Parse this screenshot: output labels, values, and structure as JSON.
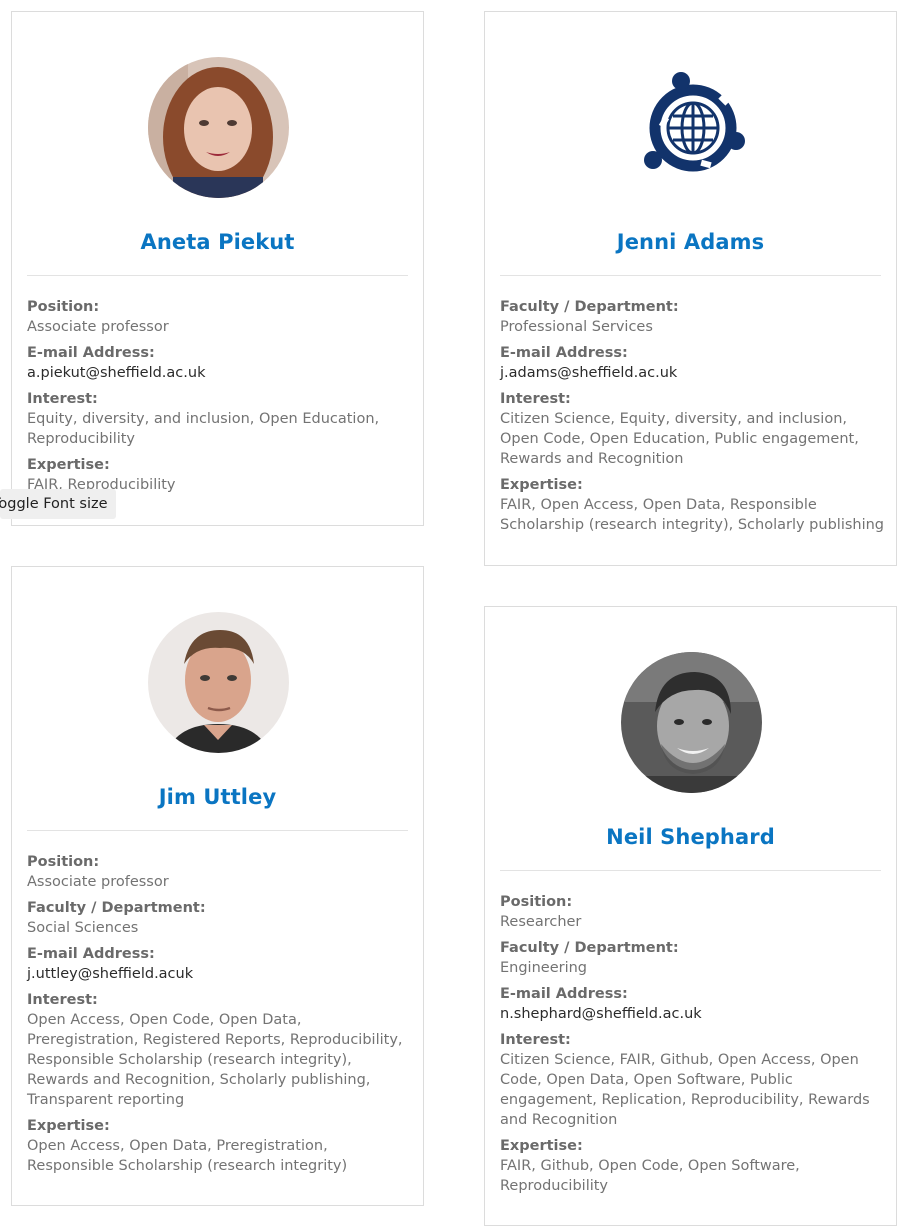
{
  "toggle_font_size": "Toggle Font size",
  "cards": [
    {
      "name": "Aneta Piekut",
      "fields": [
        {
          "label": "Position:",
          "value": "Associate professor"
        },
        {
          "label": "E-mail Address:",
          "value": "a.piekut@sheffield.ac.uk"
        },
        {
          "label": "Interest:",
          "value": "Equity, diversity, and inclusion, Open Education, Reproducibility"
        },
        {
          "label": "Expertise:",
          "value": "FAIR, Reproducibility"
        }
      ]
    },
    {
      "name": "Jenni Adams",
      "fields": [
        {
          "label": "Faculty / Department:",
          "value": "Professional Services"
        },
        {
          "label": "E-mail Address:",
          "value": "j.adams@sheffield.ac.uk"
        },
        {
          "label": "Interest:",
          "value": "Citizen Science, Equity, diversity, and inclusion, Open Code, Open Education, Public engagement, Rewards and Recognition"
        },
        {
          "label": "Expertise:",
          "value": "FAIR, Open Access, Open Data, Responsible Scholarship (research integrity), Scholarly publishing"
        }
      ]
    },
    {
      "name": "Jim Uttley",
      "fields": [
        {
          "label": "Position:",
          "value": "Associate professor"
        },
        {
          "label": "Faculty / Department:",
          "value": "Social Sciences"
        },
        {
          "label": "E-mail Address:",
          "value": "j.uttley@sheffield.acuk"
        },
        {
          "label": "Interest:",
          "value": "Open Access, Open Code, Open Data, Preregistration, Registered Reports, Reproducibility, Responsible Scholarship (research integrity), Rewards and Recognition, Scholarly publishing, Transparent reporting"
        },
        {
          "label": "Expertise:",
          "value": "Open Access, Open Data, Preregistration, Responsible Scholarship (research integrity)"
        }
      ]
    },
    {
      "name": "Neil Shephard",
      "fields": [
        {
          "label": "Position:",
          "value": "Researcher"
        },
        {
          "label": "Faculty / Department:",
          "value": "Engineering"
        },
        {
          "label": "E-mail Address:",
          "value": "n.shephard@sheffield.ac.uk"
        },
        {
          "label": "Interest:",
          "value": "Citizen Science, FAIR, Github, Open Access, Open Code, Open Data, Open Software, Public engagement, Replication, Reproducibility, Rewards and Recognition"
        },
        {
          "label": "Expertise:",
          "value": "FAIR, Github, Open Code, Open Software, Reproducibility"
        }
      ]
    }
  ]
}
